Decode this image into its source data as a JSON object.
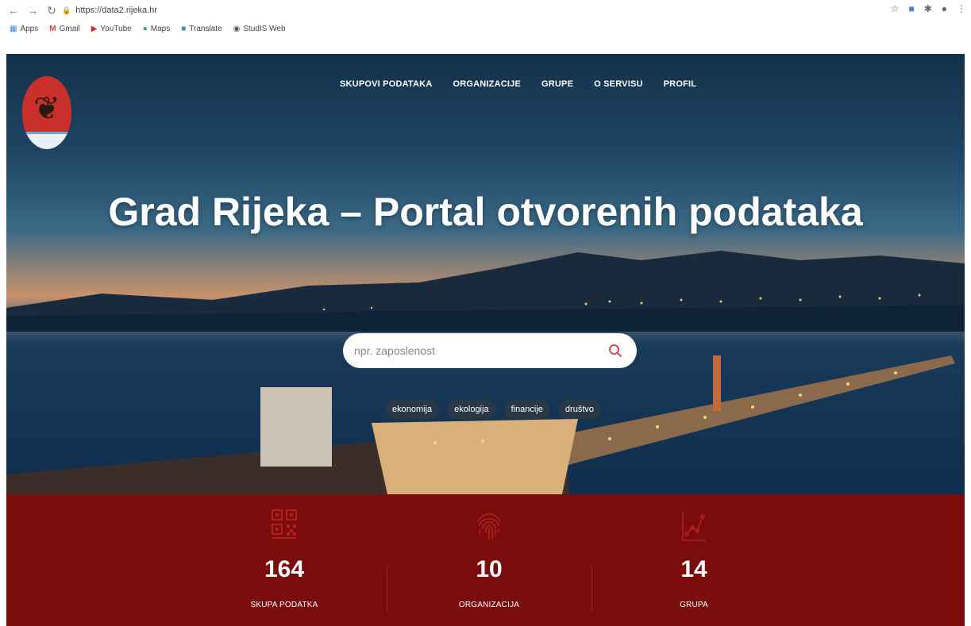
{
  "browser": {
    "url": "https://data2.rijeka.hr",
    "bookmarks": [
      "Apps",
      "Gmail",
      "YouTube",
      "Maps",
      "Translate",
      "StudIS Web"
    ]
  },
  "nav": {
    "items": [
      "SKUPOVI PODATAKA",
      "ORGANIZACIJE",
      "GRUPE",
      "O SERVISU",
      "PROFIL"
    ]
  },
  "hero": {
    "title": "Grad Rijeka – Portal otvorenih podataka",
    "search_placeholder": "npr. zaposlenost",
    "tags": [
      "ekonomija",
      "ekologija",
      "financije",
      "društvo"
    ]
  },
  "stats": [
    {
      "number": "164",
      "label": "SKUPA PODATKA",
      "icon": "qr-code-icon"
    },
    {
      "number": "10",
      "label": "ORGANIZACIJA",
      "icon": "fingerprint-icon"
    },
    {
      "number": "14",
      "label": "GRUPA",
      "icon": "line-chart-icon"
    }
  ],
  "colors": {
    "stats_bg": "#7a0c0c",
    "accent": "#d43b3b",
    "icon_red": "#b22020"
  }
}
